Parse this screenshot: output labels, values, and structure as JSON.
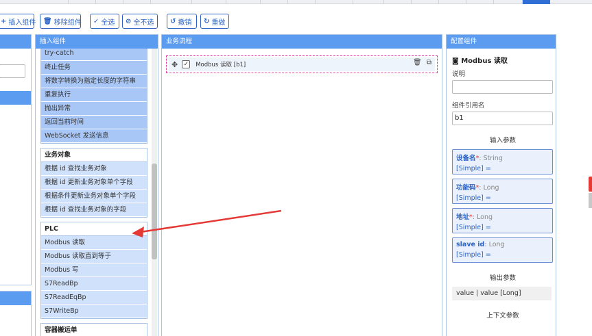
{
  "toolbar": {
    "insert": "插入组件",
    "remove": "移除组件",
    "select_all": "全选",
    "select_none": "全不选",
    "undo": "撤销",
    "redo": "重做"
  },
  "components_panel": {
    "title": "插入组件",
    "first_group_items": [
      "try-catch",
      "终止任务",
      "将数字转换为指定长度的字符串",
      "重复执行",
      "抛出异常",
      "返回当前时间",
      "WebSocket 发送信息"
    ],
    "business_group": {
      "title": "业务对象",
      "items": [
        "根据 id 查找业务对象",
        "根据 id 更新业务对象单个字段",
        "根据条件更新业务对象单个字段",
        "根据 id 查找业务对象的字段"
      ]
    },
    "plc_group": {
      "title": "PLC",
      "items": [
        "Modbus 读取",
        "Modbus 读取直到等于",
        "Modbus 写",
        "S7ReadBp",
        "S7ReadEqBp",
        "S7WriteBp"
      ]
    },
    "container_group": {
      "title": "容器搬运单"
    }
  },
  "flow_panel": {
    "title": "业务流程",
    "node": {
      "label": "Modbus 读取 [b1]"
    }
  },
  "config_panel": {
    "title": "配置组件",
    "component_title": "Modbus 读取",
    "desc_label": "说明",
    "desc_value": "",
    "ref_label": "组件引用名",
    "ref_value": "b1",
    "input_params_title": "输入参数",
    "params": [
      {
        "name": "设备名",
        "req": "*",
        "type": "String",
        "value": "[Simple] ="
      },
      {
        "name": "功能码",
        "req": "*",
        "type": "Long",
        "value": "[Simple] ="
      },
      {
        "name": "地址",
        "req": "*",
        "type": "Long",
        "value": "[Simple] ="
      },
      {
        "name": "slave id",
        "req": "",
        "type": "Long",
        "value": "[Simple] ="
      }
    ],
    "output_params_title": "输出参数",
    "output_value": "value | value [Long]",
    "context_params_title": "上下文参数"
  },
  "colors": {
    "accent": "#2c64c4",
    "panel_header": "#5b9bf0",
    "item_bg": "#cfe1fb",
    "node_border": "#e040a8",
    "arrow": "#e53935"
  }
}
